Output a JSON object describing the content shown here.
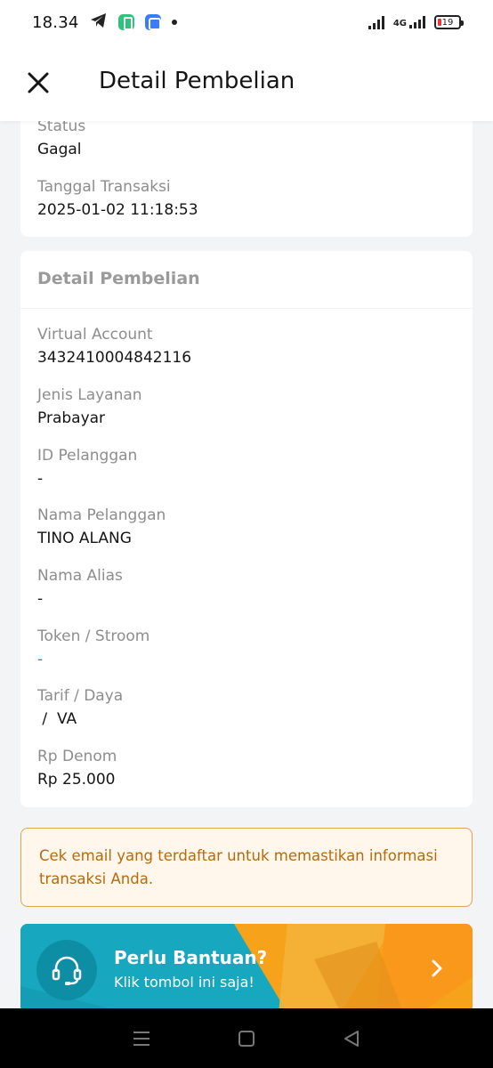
{
  "status_bar": {
    "time": "18.34",
    "network": "4G",
    "battery": "19"
  },
  "header": {
    "title": "Detail Pembelian"
  },
  "summary": {
    "status_label": "Status",
    "status_value": "Gagal",
    "date_label": "Tanggal Transaksi",
    "date_value": "2025-01-02 11:18:53"
  },
  "detail": {
    "heading": "Detail Pembelian",
    "fields": [
      {
        "label": "Virtual Account",
        "value": "3432410004842116"
      },
      {
        "label": "Jenis Layanan",
        "value": "Prabayar"
      },
      {
        "label": "ID Pelanggan",
        "value": "-"
      },
      {
        "label": "Nama Pelanggan",
        "value": "TINO ALANG"
      },
      {
        "label": "Nama Alias",
        "value": "-"
      },
      {
        "label": "Token / Stroom",
        "value": "-"
      },
      {
        "label": "Tarif / Daya",
        "value": " /  VA"
      },
      {
        "label": "Rp Denom",
        "value": "Rp 25.000"
      }
    ]
  },
  "notice": {
    "text": "Cek email yang terdaftar untuk memastikan informasi transaksi Anda."
  },
  "help": {
    "title": "Perlu Bantuan?",
    "subtitle": "Klik tombol ini saja!"
  },
  "colors": {
    "accent_teal": "#17a8c0",
    "accent_orange": "#f7a21b",
    "notice_text": "#b86a0b",
    "link_blue": "#1e88e5"
  }
}
